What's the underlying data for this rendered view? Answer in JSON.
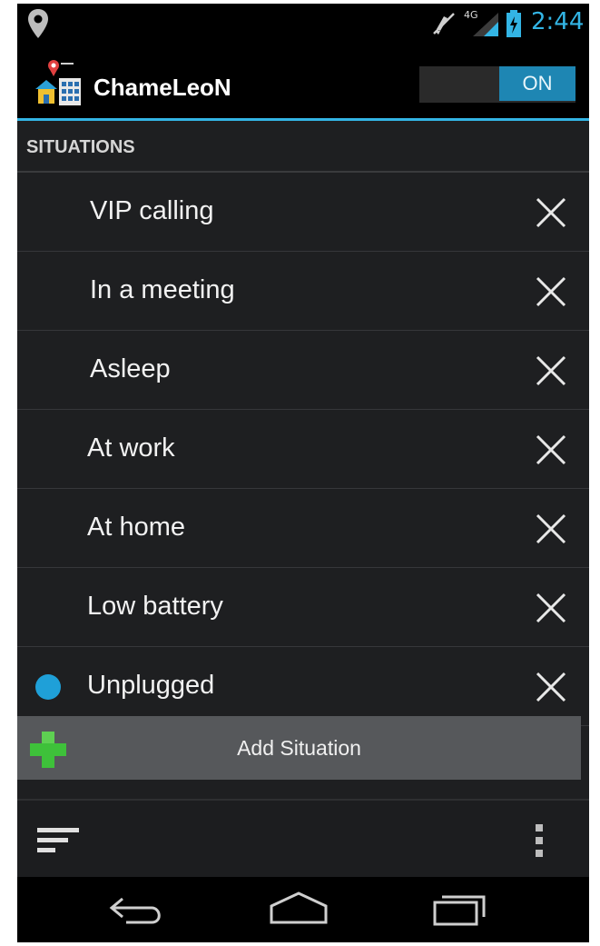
{
  "status_bar": {
    "time": "2:44",
    "network": "4G",
    "icons": [
      "location-icon",
      "mute-icon",
      "signal-icon",
      "battery-charging-icon"
    ]
  },
  "action_bar": {
    "app_title": "ChameLeoN",
    "toggle_label": "ON"
  },
  "section": {
    "title": "SITUATIONS"
  },
  "situations": [
    {
      "label": "VIP calling",
      "active": false
    },
    {
      "label": "In a meeting",
      "active": false
    },
    {
      "label": "Asleep",
      "active": false
    },
    {
      "label": "At work",
      "active": false
    },
    {
      "label": "At home",
      "active": false
    },
    {
      "label": "Low battery",
      "active": false
    },
    {
      "label": "Unplugged",
      "active": true
    }
  ],
  "add_bar": {
    "label": "Add Situation"
  },
  "colors": {
    "accent": "#33b5e5",
    "active_dot": "#1fa0d8",
    "plus_green": "#3ec13a"
  }
}
